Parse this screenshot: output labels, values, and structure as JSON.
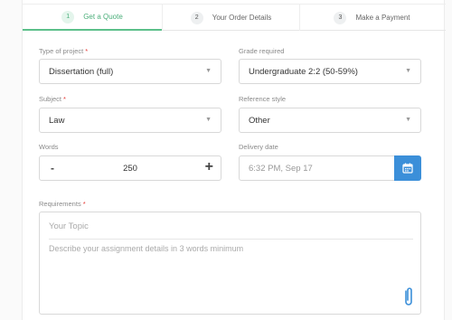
{
  "steps": [
    {
      "num": "1",
      "label": "Get a Quote"
    },
    {
      "num": "2",
      "label": "Your Order Details"
    },
    {
      "num": "3",
      "label": "Make a Payment"
    }
  ],
  "form": {
    "type_of_project": {
      "label": "Type of project",
      "required": "*",
      "value": "Dissertation (full)"
    },
    "grade_required": {
      "label": "Grade required",
      "value": "Undergraduate 2:2 (50-59%)"
    },
    "subject": {
      "label": "Subject",
      "required": "*",
      "value": "Law"
    },
    "reference_style": {
      "label": "Reference style",
      "value": "Other"
    },
    "words": {
      "label": "Words",
      "value": "250",
      "minus": "-",
      "plus": "+"
    },
    "delivery_date": {
      "label": "Delivery date",
      "value": "6:32 PM, Sep 17"
    },
    "requirements": {
      "label": "Requirements",
      "required": "*",
      "topic_placeholder": "Your Topic",
      "details_placeholder": "Describe your assignment details in 3 words minimum"
    }
  },
  "icons": {
    "dropdown": "chevron-down-icon",
    "calendar": "calendar-icon",
    "attachment": "paperclip-icon"
  },
  "colors": {
    "active_step": "#4caf7b",
    "calendar_button": "#3b8fd9",
    "required_mark": "#e53935"
  }
}
